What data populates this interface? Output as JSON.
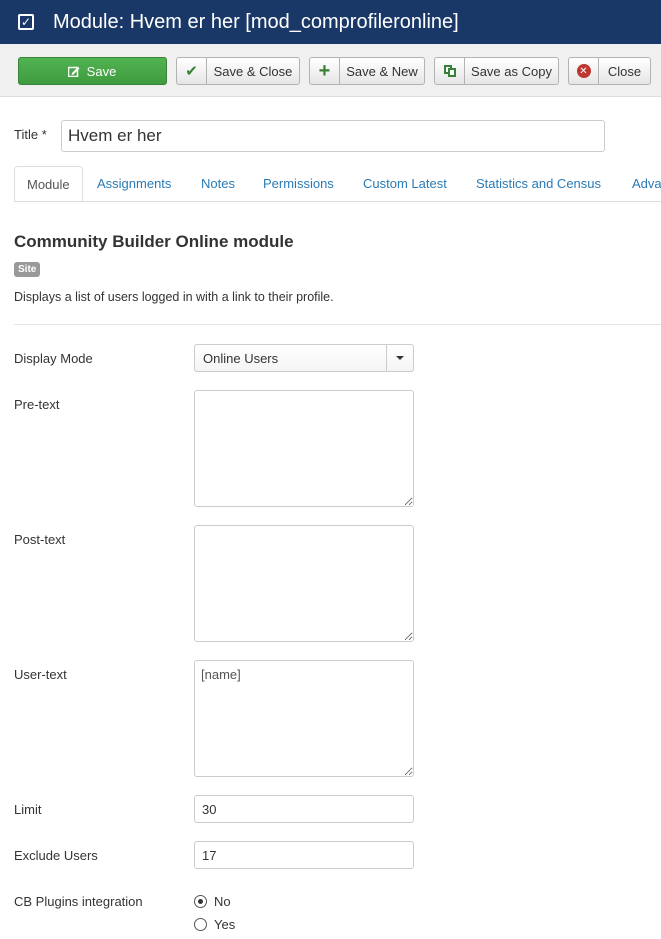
{
  "header": {
    "title": "Module: Hvem er her [mod_comprofileronline]",
    "icon": "checkbox-icon"
  },
  "toolbar": {
    "save": "Save",
    "save_close": "Save & Close",
    "save_new": "Save & New",
    "save_copy": "Save as Copy",
    "close": "Close"
  },
  "form": {
    "title_label": "Title *",
    "title_value": "Hvem er her"
  },
  "tabs": [
    "Module",
    "Assignments",
    "Notes",
    "Permissions",
    "Custom Latest",
    "Statistics and Census",
    "Adva"
  ],
  "module": {
    "name": "Community Builder Online module",
    "badge": "Site",
    "description": "Displays a list of users logged in with a link to their profile."
  },
  "fields": {
    "display_mode_label": "Display Mode",
    "display_mode_value": "Online Users",
    "pretext_label": "Pre-text",
    "pretext_value": "",
    "posttext_label": "Post-text",
    "posttext_value": "",
    "usertext_label": "User-text",
    "usertext_value": "[name]",
    "limit_label": "Limit",
    "limit_value": "30",
    "exclude_label": "Exclude Users",
    "exclude_value": "17",
    "cbplugins_label": "CB Plugins integration",
    "cbplugins_options": [
      "No",
      "Yes"
    ],
    "cbplugins_selected": "No"
  },
  "colors": {
    "header_bg": "#1a3867",
    "save_green": "#46a546",
    "link_blue": "#2a7bb5"
  }
}
